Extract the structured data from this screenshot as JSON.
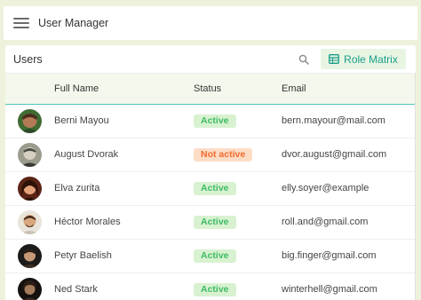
{
  "app": {
    "title": "User Manager",
    "menu_icon": "menu-icon"
  },
  "panel": {
    "title": "Users",
    "search_icon": "search-icon",
    "role_button_label": "Role Matrix",
    "role_button_icon": "table-icon"
  },
  "table": {
    "columns": [
      "Full Name",
      "Status",
      "Email"
    ],
    "rows": [
      {
        "name": "Berni Mayou",
        "status": "Active",
        "email": "bern.mayour@mail.com"
      },
      {
        "name": "August Dvorak",
        "status": "Not active",
        "email": "dvor.august@gmail.com"
      },
      {
        "name": "Elva zurita",
        "status": "Active",
        "email": "elly.soyer@example"
      },
      {
        "name": "Héctor Morales",
        "status": "Active",
        "email": "roll.and@gmail.com"
      },
      {
        "name": "Petyr Baelish",
        "status": "Active",
        "email": "big.finger@gmail.com"
      },
      {
        "name": "Ned Stark",
        "status": "Active",
        "email": "winterhell@gmail.com"
      }
    ]
  },
  "colors": {
    "active_bg": "#d8f2d1",
    "active_text": "#3dbb63",
    "inactive_bg": "#fddcc6",
    "inactive_text": "#f26b2b",
    "accent": "#1a9e8a"
  }
}
